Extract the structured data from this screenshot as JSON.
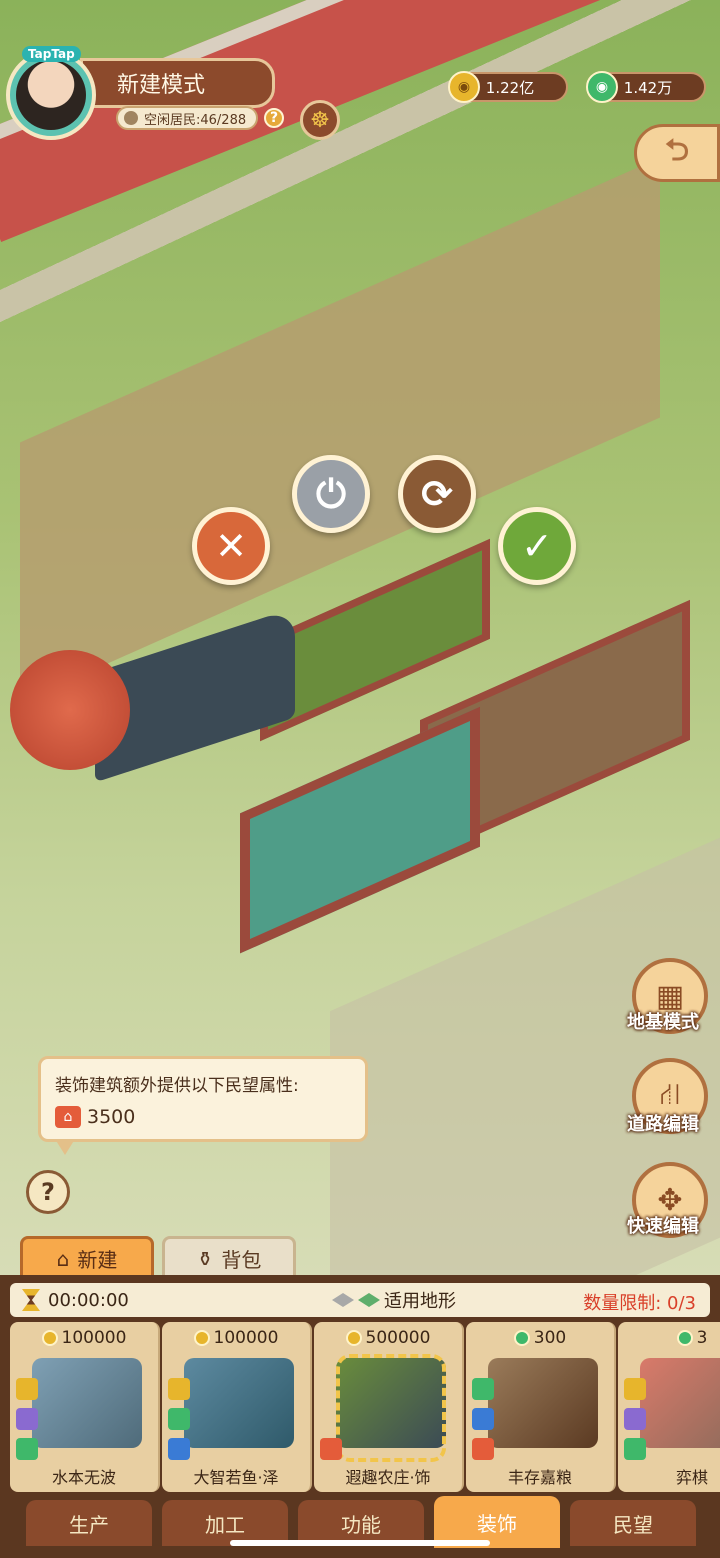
{
  "header": {
    "badge": "TapTap",
    "mode_title": "新建模式",
    "idle_residents": "空闲居民:46/288",
    "help_glyph": "?",
    "currency_gold": "1.22亿",
    "currency_jade": "1.42万"
  },
  "actions": {
    "cancel": "✕",
    "store": "⏻",
    "rotate": "⟳",
    "confirm": "✓"
  },
  "side_edit": {
    "foundation_mode": "地基模式",
    "road_edit": "道路编辑",
    "quick_edit": "快速编辑"
  },
  "tooltip": {
    "title": "装饰建筑额外提供以下民望属性:",
    "value": "3500"
  },
  "help_button": "?",
  "tabs": [
    {
      "label": "新建",
      "active": true
    },
    {
      "label": "背包",
      "active": false
    }
  ],
  "panel": {
    "timer": "00:00:00",
    "terrain_label": "适用地形",
    "limit_label": "数量限制:",
    "limit_value": "0/3"
  },
  "cards": [
    {
      "price": "100000",
      "currency": "gold",
      "name": "水本无波"
    },
    {
      "price": "100000",
      "currency": "gold",
      "name": "大智若鱼·泽"
    },
    {
      "price": "500000",
      "currency": "gold",
      "name": "遐趣农庄·饰",
      "selected": true
    },
    {
      "price": "300",
      "currency": "jade",
      "name": "丰存嘉粮"
    },
    {
      "price": "3",
      "currency": "jade",
      "name": "弈棋"
    }
  ],
  "bottom_nav": [
    {
      "label": "生产",
      "active": false
    },
    {
      "label": "加工",
      "active": false
    },
    {
      "label": "功能",
      "active": false
    },
    {
      "label": "装饰",
      "active": true
    },
    {
      "label": "民望",
      "active": false
    }
  ],
  "colors": {
    "accent_orange": "#f7a94b",
    "brown_panel": "#5b3720",
    "limit_red": "#d9402a",
    "confirm_green": "#6fa83a",
    "cancel_orange": "#d8683a"
  }
}
